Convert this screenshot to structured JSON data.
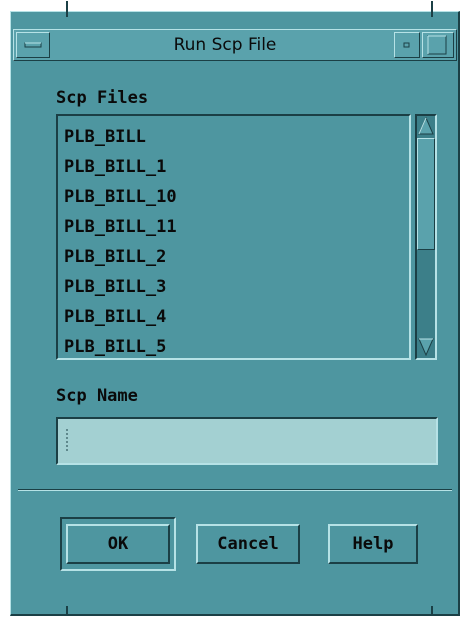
{
  "window": {
    "title": "Run Scp File"
  },
  "scp_files": {
    "label": "Scp Files",
    "items": [
      "PLB_BILL",
      "PLB_BILL_1",
      "PLB_BILL_10",
      "PLB_BILL_11",
      "PLB_BILL_2",
      "PLB_BILL_3",
      "PLB_BILL_4",
      "PLB_BILL_5"
    ]
  },
  "scp_name": {
    "label": "Scp Name",
    "value": ""
  },
  "buttons": {
    "ok": "OK",
    "cancel": "Cancel",
    "help": "Help"
  },
  "colors": {
    "background": "#4e96a0",
    "field": "#a3d0d2"
  },
  "icons": {
    "window_menu": "window-menu-icon",
    "minimize": "minimize-icon",
    "maximize": "maximize-icon",
    "scroll_up": "scroll-up-arrow-icon",
    "scroll_down": "scroll-down-arrow-icon"
  }
}
